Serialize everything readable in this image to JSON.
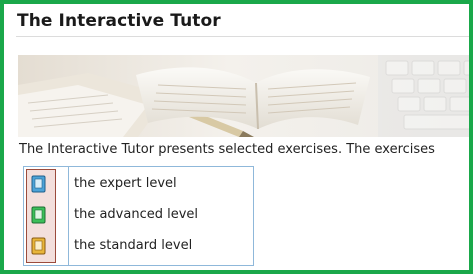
{
  "page": {
    "title": "The Interactive Tutor",
    "intro_text": "The Interactive Tutor presents selected exercises. The exercises"
  },
  "levels": [
    {
      "label": "the expert level",
      "icon": "blue-book-icon",
      "color": "#4da3d8"
    },
    {
      "label": "the advanced level",
      "icon": "green-book-icon",
      "color": "#3cbf5a"
    },
    {
      "label": "the standard level",
      "icon": "yellow-book-icon",
      "color": "#e8b53a"
    }
  ],
  "colors": {
    "frame_border": "#1aa84a",
    "table_border": "#8fb8da",
    "icon_column_bg": "#f3dfdc",
    "icon_column_border": "#9b4b3c"
  }
}
